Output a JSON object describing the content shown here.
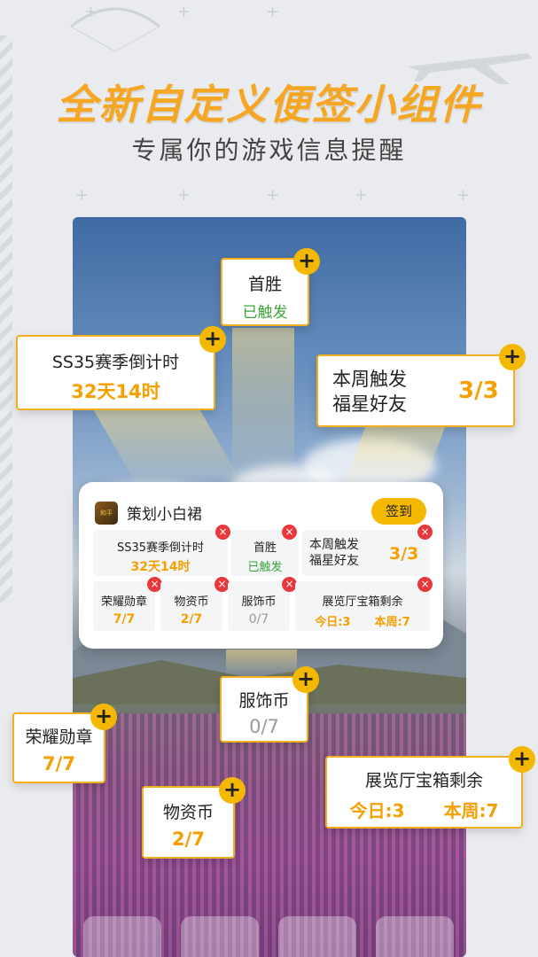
{
  "headline": "全新自定义便签小组件",
  "subline": "专属你的游戏信息提醒",
  "callouts": {
    "first_win": {
      "title": "首胜",
      "value": "已触发"
    },
    "season": {
      "title": "SS35赛季倒计时",
      "value": "32天14时"
    },
    "weekly": {
      "title1": "本周触发",
      "title2": "福星好友",
      "value": "3/3"
    },
    "costume": {
      "title": "服饰币",
      "value": "0/7"
    },
    "honor": {
      "title": "荣耀勋章",
      "value": "7/7"
    },
    "supply": {
      "title": "物资币",
      "value": "2/7"
    },
    "gallery": {
      "title": "展览厅宝箱剩余",
      "today": "今日:3",
      "week": "本周:7"
    }
  },
  "widget": {
    "name": "策划小白裙",
    "sign_label": "签到",
    "season": {
      "title": "SS35赛季倒计时",
      "value": "32天14时"
    },
    "first_win": {
      "title": "首胜",
      "value": "已触发"
    },
    "weekly": {
      "title1": "本周触发",
      "title2": "福星好友",
      "value": "3/3"
    },
    "honor": {
      "title": "荣耀勋章",
      "value": "7/7"
    },
    "supply": {
      "title": "物资币",
      "value": "2/7"
    },
    "costume": {
      "title": "服饰币",
      "value": "0/7"
    },
    "gallery": {
      "title": "展览厅宝箱剩余",
      "today": "今日:3",
      "week": "本周:7"
    }
  },
  "colors": {
    "accent": "#f5b800",
    "value": "#f5a000",
    "green": "#3aa63a",
    "gray": "#9a9a9a",
    "remove": "#e8383b"
  }
}
